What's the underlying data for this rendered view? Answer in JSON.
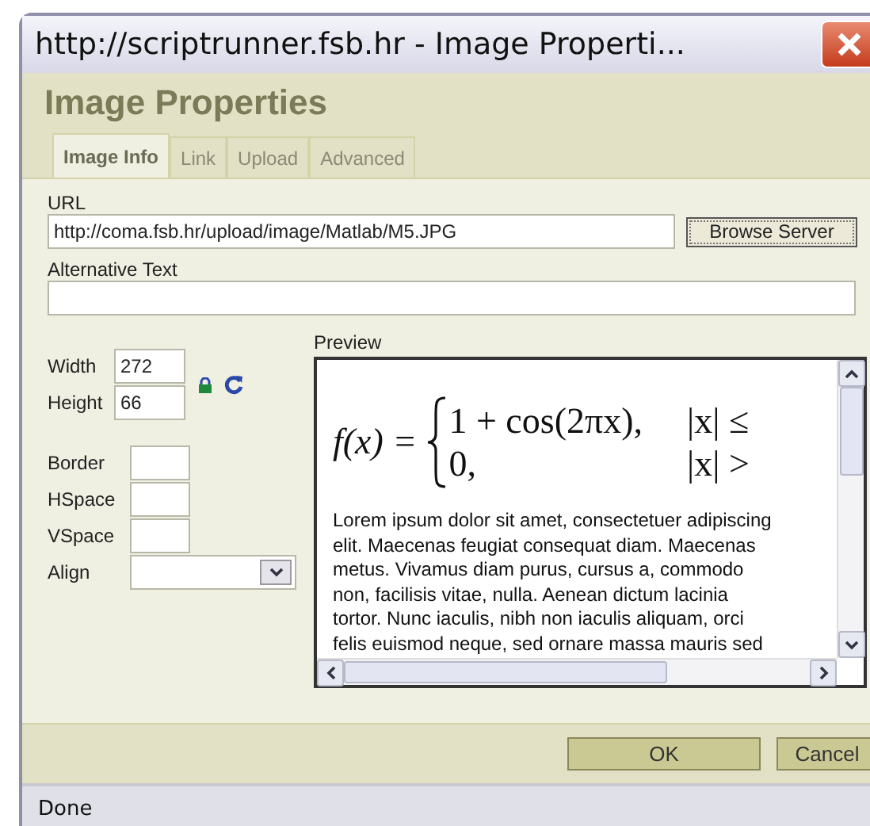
{
  "window": {
    "title": "http://scriptrunner.fsb.hr - Image Properti..."
  },
  "dialog": {
    "title": "Image Properties"
  },
  "tabs": [
    {
      "label": "Image Info",
      "selected": true
    },
    {
      "label": "Link",
      "selected": false
    },
    {
      "label": "Upload",
      "selected": false
    },
    {
      "label": "Advanced",
      "selected": false
    }
  ],
  "url": {
    "label": "URL",
    "value": "http://coma.fsb.hr/upload/image/Matlab/M5.JPG",
    "browse_button": "Browse Server"
  },
  "alternative_text": {
    "label": "Alternative Text"
  },
  "size": [
    {
      "label": "Width",
      "value": "272"
    },
    {
      "label": "Height",
      "value": "66"
    }
  ],
  "spacing": [
    {
      "label": "Border",
      "kind": "text"
    },
    {
      "label": "HSpace",
      "kind": "text"
    },
    {
      "label": "VSpace",
      "kind": "text"
    },
    {
      "label": "Align",
      "kind": "select"
    }
  ],
  "preview": {
    "label": "Preview",
    "formula": {
      "lhs": "f(x) =",
      "cases": [
        {
          "value": "1 + cos(2πx),",
          "condition": "|x| ≤"
        },
        {
          "value": "0,",
          "condition": "|x| >"
        }
      ]
    },
    "text": "Lorem ipsum dolor sit amet, consectetuer adipiscing elit. Maecenas feugiat consequat diam. Maecenas metus. Vivamus diam purus, cursus a, commodo non, facilisis vitae, nulla. Aenean dictum lacinia tortor. Nunc iaculis, nibh non iaculis aliquam, orci felis euismod neque, sed ornare massa mauris sed"
  },
  "buttons": [
    {
      "label": "OK",
      "kind": "ok"
    },
    {
      "label": "Cancel",
      "kind": "cancel"
    }
  ],
  "status_bar": {
    "text": "Done"
  }
}
